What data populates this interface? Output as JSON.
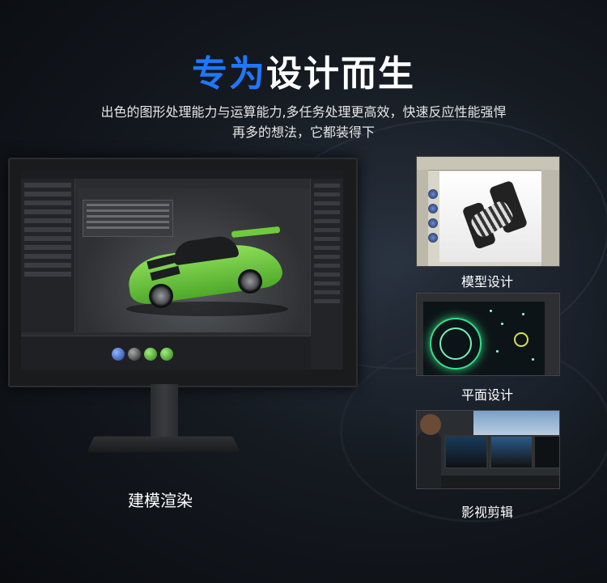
{
  "header": {
    "title_highlight": "专为",
    "title_rest": "设计而生",
    "subtitle_line1": "出色的图形处理能力与运算能力,多任务处理更高效，快速反应性能强悍",
    "subtitle_line2": "再多的想法，它都装得下"
  },
  "monitor": {
    "caption": "建模渲染"
  },
  "gallery": [
    {
      "caption": "模型设计"
    },
    {
      "caption": "平面设计"
    },
    {
      "caption": "影视剪辑"
    }
  ],
  "colors": {
    "accent": "#1e78ff",
    "car_green": "#6fcb3c"
  }
}
